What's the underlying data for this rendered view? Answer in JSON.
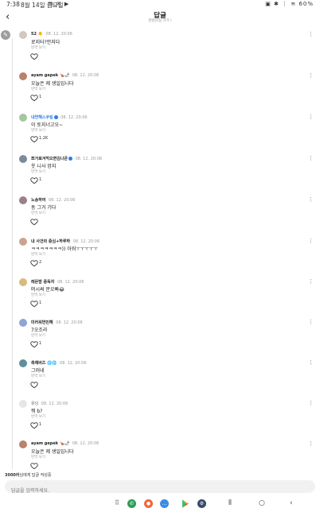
{
  "status_bar": {
    "time": "7:38",
    "date": "8월 14일 금요일",
    "battery": "60%"
  },
  "header": {
    "title": "답글",
    "subtitle": "관련나실 기기 \\"
  },
  "comments": [
    {
      "user": "52",
      "time": "08. 12. 20:06",
      "text": "로지터?안지다",
      "translate": "번역 보기",
      "likes": "",
      "avatar_color": "#cfc9c0"
    },
    {
      "user": "ayam gepek",
      "time": "08. 12. 20:06",
      "text": "오늘은 제 생일입니다",
      "translate": "번역 보기",
      "likes": "1",
      "avatar_color": "#b9826c"
    },
    {
      "user": "내연해스쿠림",
      "time": "08. 12. 20:06",
      "text": "이 토지너고오~",
      "translate": "번역 보기",
      "likes": "1.2K",
      "avatar_color": "#a4c7a0"
    },
    {
      "user": "쪼거로겨먹으면김나큰",
      "time": "08. 12. 20:06",
      "text": "웃 니사 망지",
      "translate": "번역 보기",
      "likes": "1",
      "avatar_color": "#7d8a9c"
    },
    {
      "user": "노송하여",
      "time": "08. 12. 20:06",
      "text": "동 그거 기다",
      "translate": "번역 보기",
      "likes": "",
      "avatar_color": "#9a7f8c"
    },
    {
      "user": "내 사건의 중심+하루하",
      "time": "08. 12. 20:06",
      "text": "ㅋㅋㅋㅋㅋㅋㅋ)) 아워ㅜㅜㅜㅜㅜ",
      "translate": "번역 보기",
      "likes": "2",
      "avatar_color": "#c9a58e"
    },
    {
      "user": "레몬밤 중독자",
      "time": "08. 12. 20:06",
      "text": "머시써 문오빠😂",
      "translate": "번역 보기",
      "likes": "1",
      "avatar_color": "#d8b97e"
    },
    {
      "user": "미러워연민해",
      "time": "08. 12. 20:06",
      "text": "7오조라",
      "translate": "번역 보기",
      "likes": "1",
      "avatar_color": "#8ea6d1"
    },
    {
      "user": "측채버즈",
      "time": "08. 12. 20:06",
      "text": "그러네",
      "translate": "번역 보기",
      "likes": "",
      "avatar_color": "#5f8f9c"
    },
    {
      "user": "유닝",
      "time": "08. 12. 20:06",
      "text": "뭐 b?",
      "translate": "번역 보기",
      "likes": "1",
      "avatar_color": "#e6e6e6"
    },
    {
      "user": "ayam gepek",
      "time": "08. 12. 20:06",
      "text": "오늘은 제 생일입니다",
      "translate": "번역 보기",
      "likes": "",
      "avatar_color": "#b9826c"
    }
  ],
  "footer": {
    "note_bold": "3000러",
    "note_rest": "님에게 답글 작성중",
    "placeholder": "답글을 입력하세요."
  },
  "nav_apps": [
    {
      "icon": "grid-icon",
      "color": "#ffffff"
    },
    {
      "icon": "phone-icon",
      "color": "#2e9e5a"
    },
    {
      "icon": "contacts-icon",
      "color": "#f0673a"
    },
    {
      "icon": "messages-icon",
      "color": "#3b8ce3"
    },
    {
      "icon": "play-store-icon",
      "color": "#ffffff"
    },
    {
      "icon": "settings-icon",
      "color": "#3a4a6a"
    }
  ]
}
